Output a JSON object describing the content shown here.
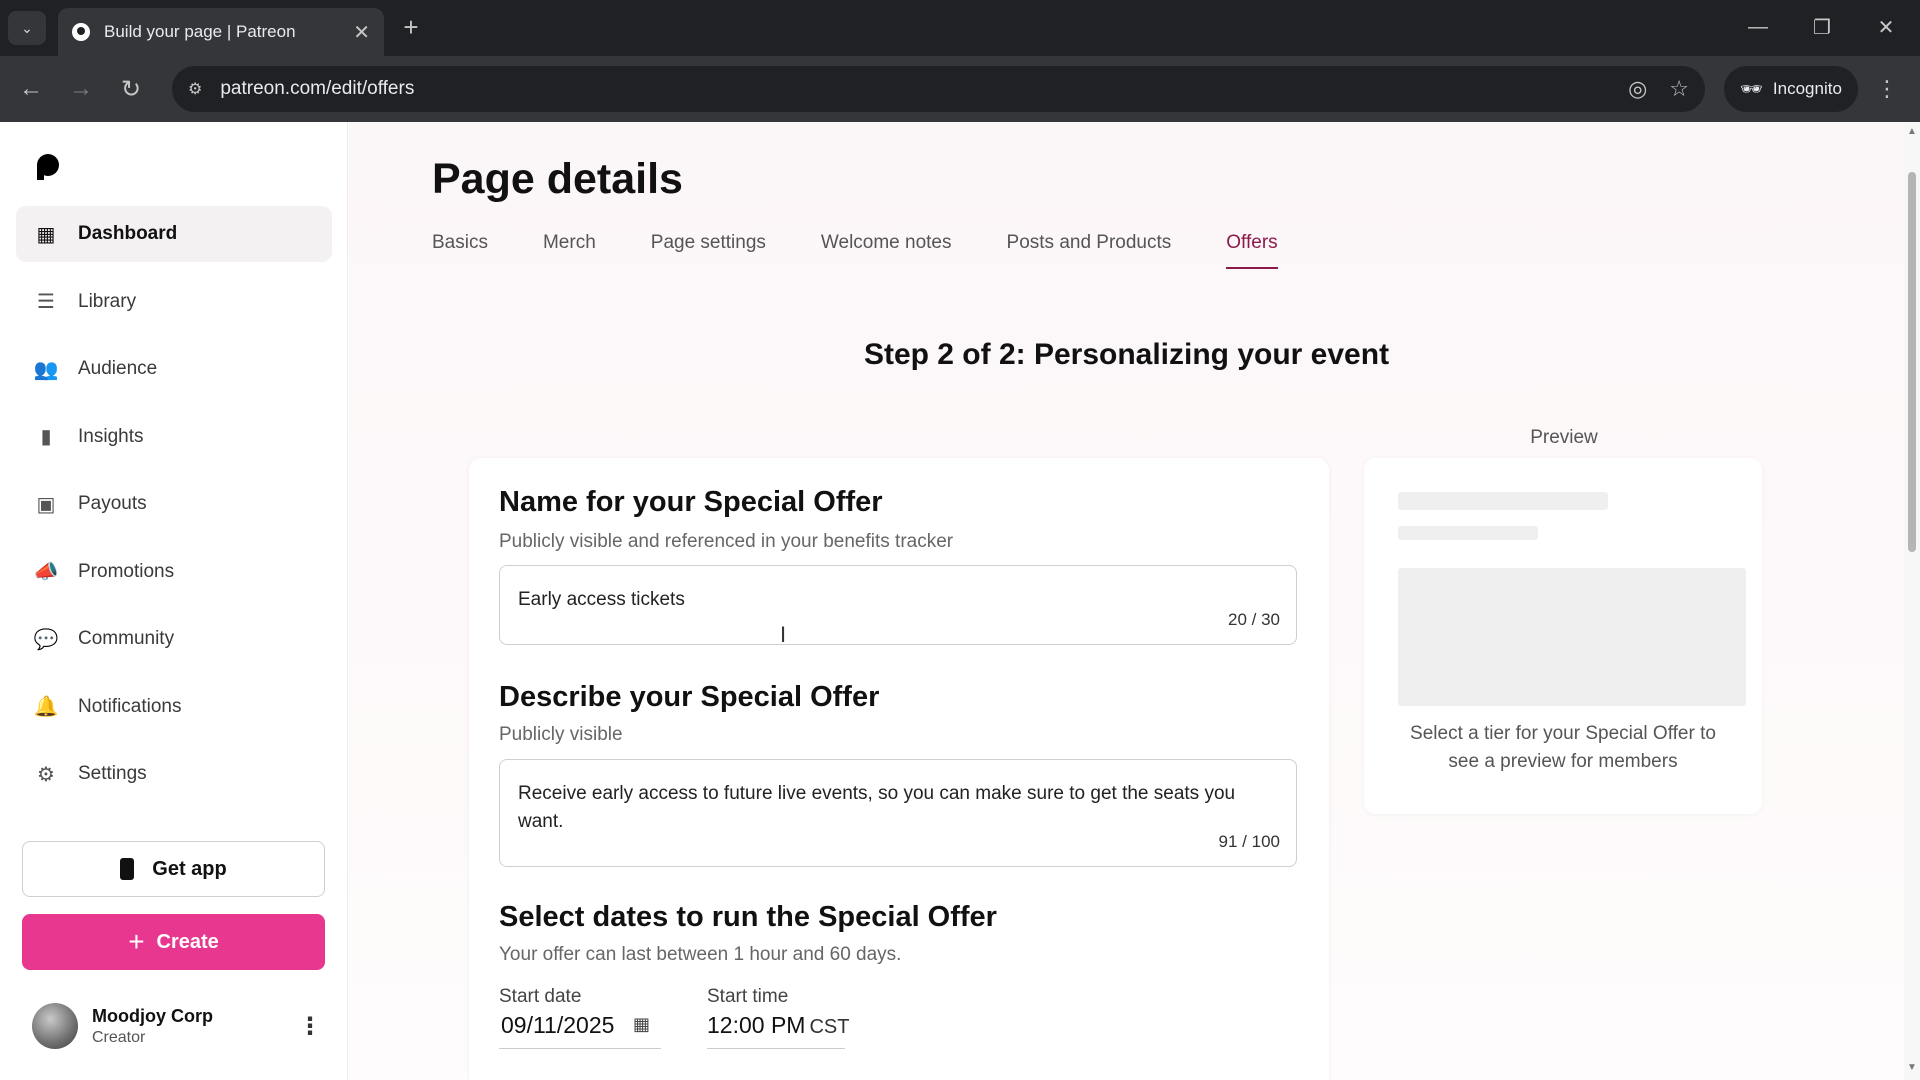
{
  "browser": {
    "tab_title": "Build your page | Patreon",
    "url": "patreon.com/edit/offers",
    "incognito_label": "Incognito"
  },
  "sidebar": {
    "items": [
      {
        "label": "Dashboard",
        "icon": "dashboard-icon"
      },
      {
        "label": "Library",
        "icon": "library-icon"
      },
      {
        "label": "Audience",
        "icon": "audience-icon"
      },
      {
        "label": "Insights",
        "icon": "insights-icon"
      },
      {
        "label": "Payouts",
        "icon": "payouts-icon"
      },
      {
        "label": "Promotions",
        "icon": "megaphone-icon"
      },
      {
        "label": "Community",
        "icon": "chat-icon"
      },
      {
        "label": "Notifications",
        "icon": "bell-icon"
      },
      {
        "label": "Settings",
        "icon": "gear-icon"
      }
    ],
    "get_app_label": "Get app",
    "create_label": "Create",
    "user": {
      "name": "Moodjoy Corp",
      "role": "Creator"
    }
  },
  "main": {
    "title": "Page details",
    "tabs": [
      "Basics",
      "Merch",
      "Page settings",
      "Welcome notes",
      "Posts and Products",
      "Offers"
    ],
    "active_tab": "Offers",
    "step_title": "Step 2 of 2: Personalizing your event",
    "name_section": {
      "title": "Name for your Special Offer",
      "subtitle": "Publicly visible and referenced in your benefits tracker",
      "value": "Early access tickets",
      "count": "20 / 30"
    },
    "describe_section": {
      "title": "Describe your Special Offer",
      "subtitle": "Publicly visible",
      "value": "Receive early access to future live events, so you can make sure to get the seats you want.",
      "count": "91 / 100"
    },
    "dates_section": {
      "title": "Select dates to run the Special Offer",
      "subtitle": "Your offer can last between 1 hour and 60 days.",
      "start_date_label": "Start date",
      "start_date": "09/11/2025",
      "start_time_label": "Start time",
      "start_time": "12:00 PM",
      "timezone": "CST"
    },
    "preview": {
      "label": "Preview",
      "message": "Select a tier for your Special Offer to see a preview for members"
    }
  },
  "colors": {
    "accent": "#e7378f",
    "active_tab": "#8c1a4b"
  }
}
